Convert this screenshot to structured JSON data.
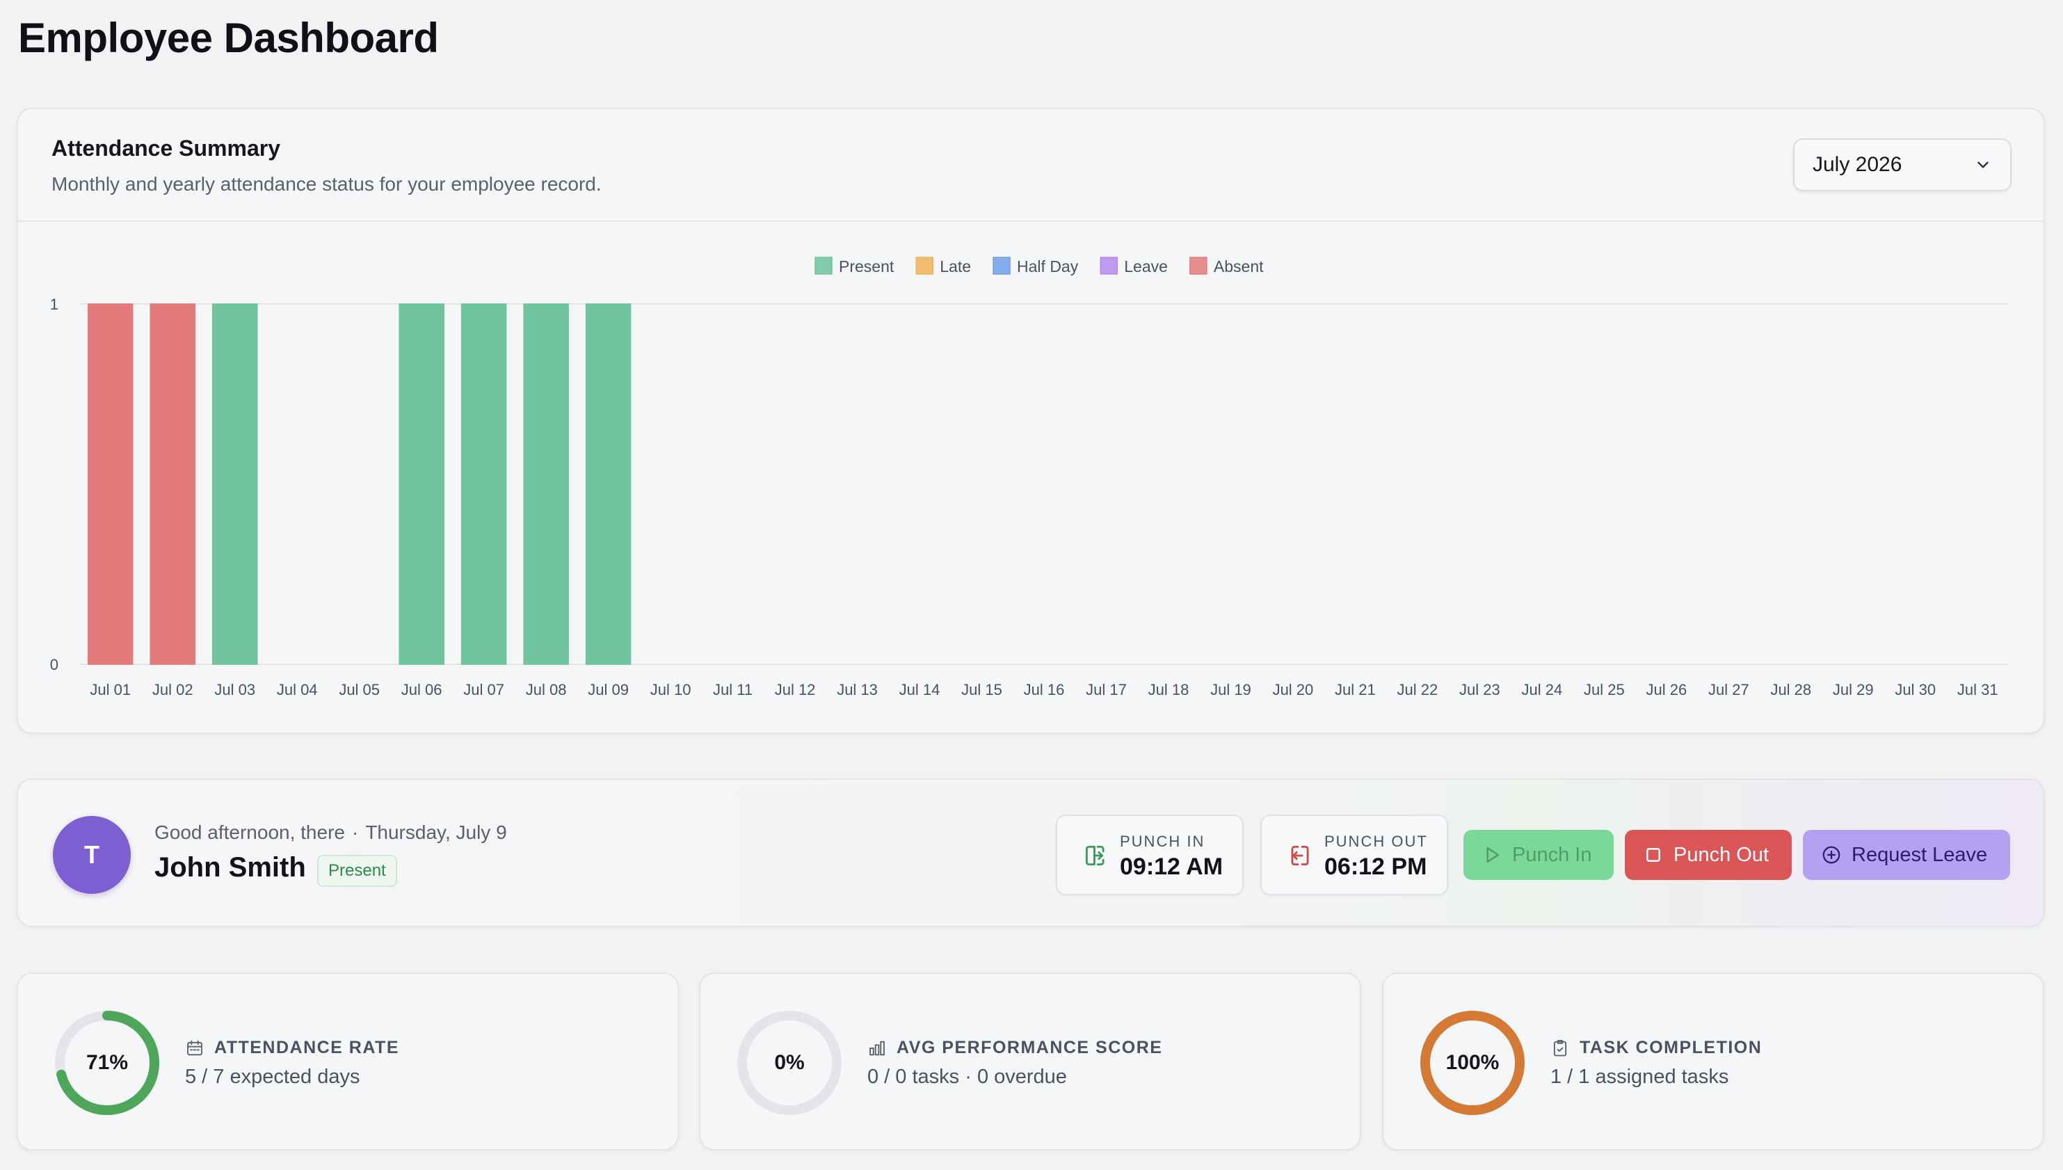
{
  "page": {
    "title": "Employee Dashboard"
  },
  "attendance": {
    "title": "Attendance Summary",
    "subtitle": "Monthly and yearly attendance status for your employee record.",
    "month_select": {
      "value": "July 2026"
    }
  },
  "chart_data": {
    "type": "bar",
    "title": "",
    "xlabel": "",
    "ylabel": "",
    "ylim": [
      0,
      1
    ],
    "yticks": [
      "0",
      "1"
    ],
    "grid": "horizontal",
    "legend_position": "top-center",
    "legend": [
      {
        "name": "Present",
        "color": "#6fc49e"
      },
      {
        "name": "Late",
        "color": "#eeb35c"
      },
      {
        "name": "Half Day",
        "color": "#6f9fe8"
      },
      {
        "name": "Leave",
        "color": "#b58af0"
      },
      {
        "name": "Absent",
        "color": "#e27b7a"
      }
    ],
    "categories": [
      "Jul 01",
      "Jul 02",
      "Jul 03",
      "Jul 04",
      "Jul 05",
      "Jul 06",
      "Jul 07",
      "Jul 08",
      "Jul 09",
      "Jul 10",
      "Jul 11",
      "Jul 12",
      "Jul 13",
      "Jul 14",
      "Jul 15",
      "Jul 16",
      "Jul 17",
      "Jul 18",
      "Jul 19",
      "Jul 20",
      "Jul 21",
      "Jul 22",
      "Jul 23",
      "Jul 24",
      "Jul 25",
      "Jul 26",
      "Jul 27",
      "Jul 28",
      "Jul 29",
      "Jul 30",
      "Jul 31"
    ],
    "series": [
      {
        "name": "Present",
        "values": [
          0,
          0,
          1,
          0,
          0,
          1,
          1,
          1,
          1,
          0,
          0,
          0,
          0,
          0,
          0,
          0,
          0,
          0,
          0,
          0,
          0,
          0,
          0,
          0,
          0,
          0,
          0,
          0,
          0,
          0,
          0
        ]
      },
      {
        "name": "Late",
        "values": [
          0,
          0,
          0,
          0,
          0,
          0,
          0,
          0,
          0,
          0,
          0,
          0,
          0,
          0,
          0,
          0,
          0,
          0,
          0,
          0,
          0,
          0,
          0,
          0,
          0,
          0,
          0,
          0,
          0,
          0,
          0
        ]
      },
      {
        "name": "Half Day",
        "values": [
          0,
          0,
          0,
          0,
          0,
          0,
          0,
          0,
          0,
          0,
          0,
          0,
          0,
          0,
          0,
          0,
          0,
          0,
          0,
          0,
          0,
          0,
          0,
          0,
          0,
          0,
          0,
          0,
          0,
          0,
          0
        ]
      },
      {
        "name": "Leave",
        "values": [
          0,
          0,
          0,
          0,
          0,
          0,
          0,
          0,
          0,
          0,
          0,
          0,
          0,
          0,
          0,
          0,
          0,
          0,
          0,
          0,
          0,
          0,
          0,
          0,
          0,
          0,
          0,
          0,
          0,
          0,
          0
        ]
      },
      {
        "name": "Absent",
        "values": [
          1,
          1,
          0,
          0,
          0,
          0,
          0,
          0,
          0,
          0,
          0,
          0,
          0,
          0,
          0,
          0,
          0,
          0,
          0,
          0,
          0,
          0,
          0,
          0,
          0,
          0,
          0,
          0,
          0,
          0,
          0
        ]
      }
    ]
  },
  "employee": {
    "initial": "T",
    "greeting": "Good afternoon, there",
    "separator": "·",
    "date": "Thursday, July 9",
    "name": "John Smith",
    "status": "Present",
    "avatar_color": "#7d5fd2"
  },
  "punch": {
    "in_label": "PUNCH IN",
    "in_time": "09:12 AM",
    "out_label": "PUNCH OUT",
    "out_time": "06:12 PM"
  },
  "actions": {
    "punch_in": "Punch In",
    "punch_out": "Punch Out",
    "request_leave": "Request Leave"
  },
  "stats": [
    {
      "ring_text": "71%",
      "percent": 71,
      "color": "#4ea65a",
      "label": "ATTENDANCE RATE",
      "icon": "calendar-icon",
      "sub": "5 / 7 expected days"
    },
    {
      "ring_text": "0%",
      "percent": 0,
      "color": "#9aa0a6",
      "label": "AVG PERFORMANCE SCORE",
      "icon": "bar-chart-icon",
      "sub": "0 / 0 tasks · 0 overdue"
    },
    {
      "ring_text": "100%",
      "percent": 100,
      "color": "#d47a35",
      "label": "TASK COMPLETION",
      "icon": "clipboard-check-icon",
      "sub": "1 / 1 assigned tasks"
    }
  ]
}
